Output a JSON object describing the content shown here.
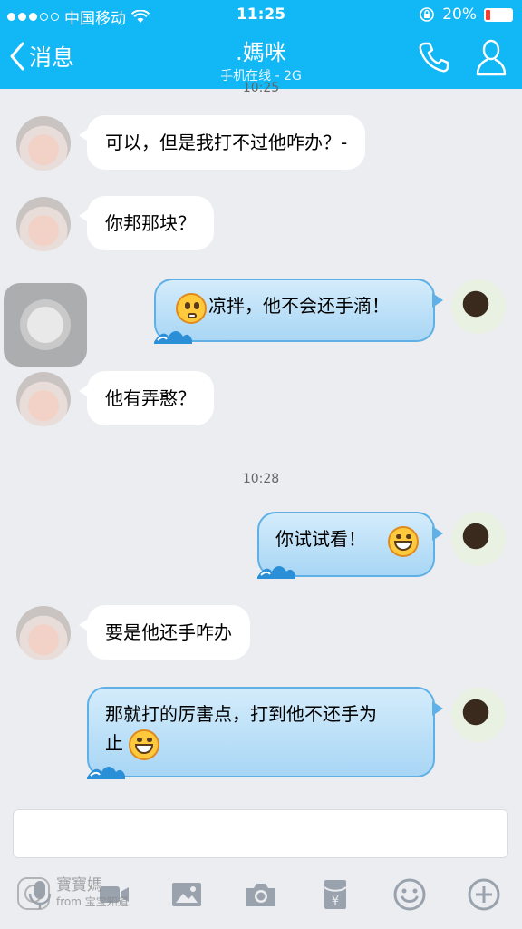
{
  "status_bar": {
    "carrier": "中国移动",
    "time": "11:25",
    "battery": "20%",
    "battery_level": 0.2
  },
  "nav": {
    "back_label": "消息",
    "title": ".媽咪",
    "subtitle": "手机在线 - 2G"
  },
  "messages": [
    {
      "side": "in",
      "text": "可以，但是我打不过他咋办？-"
    },
    {
      "side": "in",
      "text": "你邦那块？"
    },
    {
      "side": "out",
      "text": "凉拌，他不会还手滴！"
    },
    {
      "side": "in",
      "text": "他有弄憨？"
    },
    {
      "side": "out",
      "text": "你试试看！"
    },
    {
      "side": "in",
      "text": "要是他还手咋办"
    },
    {
      "side": "out",
      "text_line1": "那就打的厉害点，打到他不还手为",
      "text_line2": "止"
    }
  ],
  "timestamps": {
    "top_partial": "10:25",
    "middle": "10:28"
  },
  "watermark": {
    "line1": "寶寶媽",
    "line2": "from 宝宝知道"
  },
  "colors": {
    "header": "#12b7f5",
    "background": "#ebedf0",
    "bubble_out": "#a8d6f5",
    "bubble_in": "#ffffff"
  }
}
